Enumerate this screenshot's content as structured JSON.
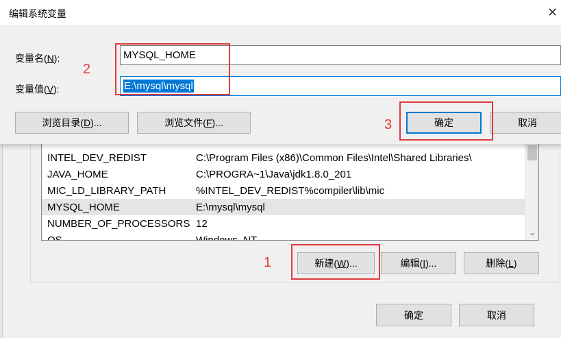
{
  "edit_dialog": {
    "title": "编辑系统变量",
    "close_glyph": "✕",
    "name_label_prefix": "变量名(",
    "name_label_key": "N",
    "name_label_suffix": "):",
    "name_value": "MYSQL_HOME",
    "value_label_prefix": "变量值(",
    "value_label_key": "V",
    "value_label_suffix": "):",
    "value_value": "E:\\mysql\\mysql",
    "browse_dir_prefix": "浏览目录(",
    "browse_dir_key": "D",
    "browse_dir_suffix": ")...",
    "browse_file_prefix": "浏览文件(",
    "browse_file_key": "F",
    "browse_file_suffix": ")...",
    "ok_label": "确定",
    "cancel_label": "取消"
  },
  "env_dialog": {
    "variables": [
      {
        "name": "INTEL_DEV_REDIST",
        "value": "C:\\Program Files (x86)\\Common Files\\Intel\\Shared Libraries\\"
      },
      {
        "name": "JAVA_HOME",
        "value": "C:\\PROGRA~1\\Java\\jdk1.8.0_201"
      },
      {
        "name": "MIC_LD_LIBRARY_PATH",
        "value": "%INTEL_DEV_REDIST%compiler\\lib\\mic"
      },
      {
        "name": "MYSQL_HOME",
        "value": "E:\\mysql\\mysql"
      },
      {
        "name": "NUMBER_OF_PROCESSORS",
        "value": "12"
      },
      {
        "name": "OS",
        "value": "Windows_NT"
      }
    ],
    "selected_variable": "MYSQL_HOME",
    "new_prefix": "新建(",
    "new_key": "W",
    "new_suffix": ")...",
    "edit_prefix": "编辑(",
    "edit_key": "I",
    "edit_suffix": ")...",
    "delete_prefix": "删除(",
    "delete_key": "L",
    "delete_suffix": ")",
    "ok_label": "确定",
    "cancel_label": "取消",
    "scroll_down_glyph": "⌄"
  },
  "annotations": {
    "n1": "1",
    "n2": "2",
    "n3": "3",
    "color": "#e03b3b"
  },
  "colors": {
    "accent": "#0078d7",
    "selection_text_bg": "#0078d7",
    "row_selected_bg": "#e5e5e5"
  }
}
